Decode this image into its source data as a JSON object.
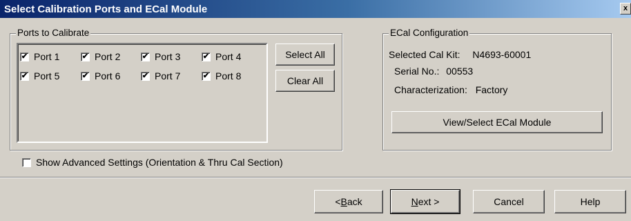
{
  "window": {
    "title": "Select Calibration Ports and ECal Module",
    "close_glyph": "x"
  },
  "ports_group": {
    "title": "Ports to Calibrate",
    "ports": [
      {
        "label": "Port 1",
        "checked": true
      },
      {
        "label": "Port 2",
        "checked": true
      },
      {
        "label": "Port 3",
        "checked": true
      },
      {
        "label": "Port 4",
        "checked": true
      },
      {
        "label": "Port 5",
        "checked": true
      },
      {
        "label": "Port 6",
        "checked": true
      },
      {
        "label": "Port 7",
        "checked": true
      },
      {
        "label": "Port 8",
        "checked": true
      }
    ],
    "select_all_label": "Select All",
    "clear_all_label": "Clear All"
  },
  "advanced": {
    "label": "Show Advanced Settings (Orientation & Thru Cal Section)",
    "checked": false
  },
  "ecal_group": {
    "title": "ECal Configuration",
    "selected_cal_kit_label": "Selected Cal Kit:",
    "selected_cal_kit_value": "N4693-60001",
    "serial_label": "Serial No.:",
    "serial_value": "00553",
    "characterization_label": "Characterization:",
    "characterization_value": "Factory",
    "view_select_label": "View/Select ECal Module"
  },
  "footer": {
    "back_prefix": "<",
    "back_mnemonic": "B",
    "back_rest": "ack",
    "next_mnemonic": "N",
    "next_rest": "ext >",
    "cancel_label": "Cancel",
    "help_label": "Help"
  },
  "check_glyph": "✔"
}
